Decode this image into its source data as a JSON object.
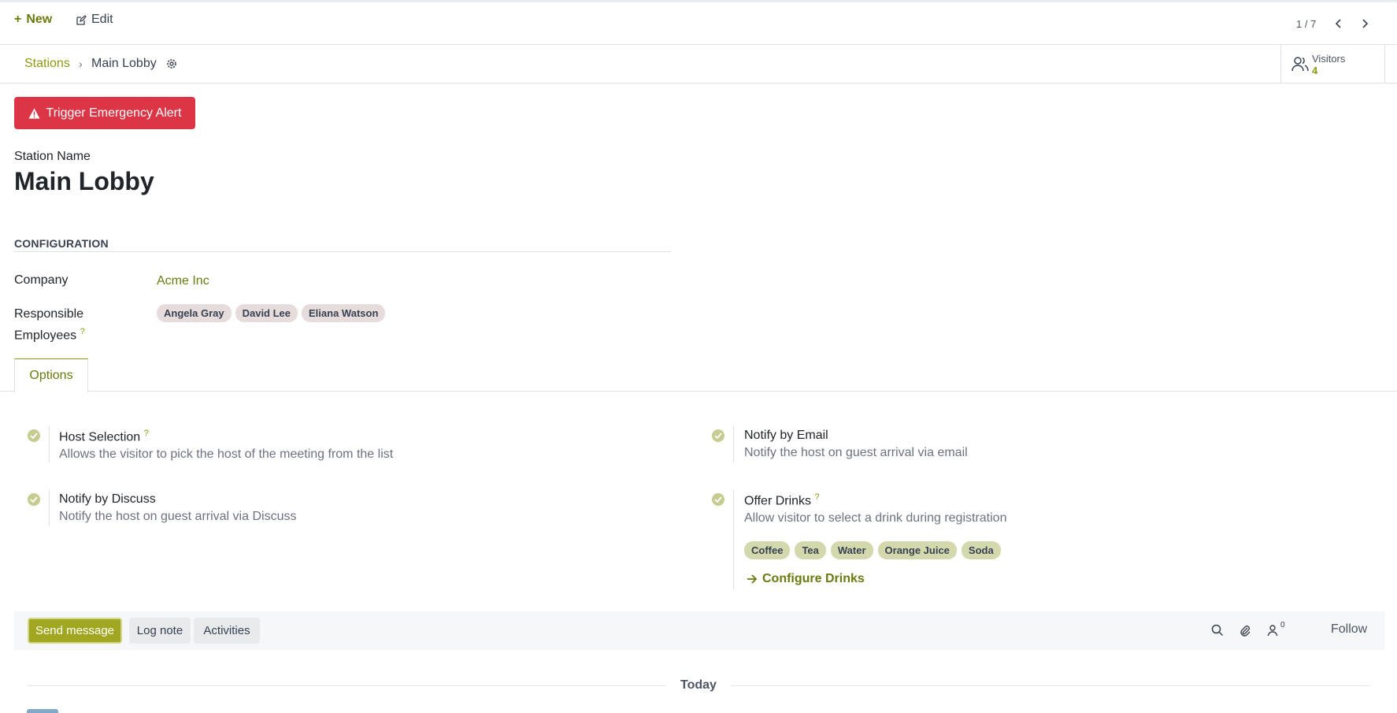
{
  "toolbar": {
    "new_label": "New",
    "edit_label": "Edit",
    "pager": "1 / 7"
  },
  "breadcrumb": {
    "parent": "Stations",
    "current": "Main Lobby"
  },
  "visitors": {
    "label": "Visitors",
    "count": "4"
  },
  "alert": {
    "label": "Trigger Emergency Alert"
  },
  "station": {
    "label": "Station Name",
    "name": "Main Lobby"
  },
  "configuration": {
    "title": "CONFIGURATION",
    "company_label": "Company",
    "company_value": "Acme Inc",
    "responsible_label_1": "Responsible",
    "responsible_label_2": "Employees",
    "help_mark": "?",
    "employees": [
      "Angela Gray",
      "David Lee",
      "Eliana Watson"
    ]
  },
  "tabs": {
    "options": "Options"
  },
  "options": {
    "host_selection": {
      "title": "Host Selection",
      "desc": "Allows the visitor to pick the host of the meeting from the list"
    },
    "notify_email": {
      "title": "Notify by Email",
      "desc": "Notify the host on guest arrival via email"
    },
    "notify_discuss": {
      "title": "Notify by Discuss",
      "desc": "Notify the host on guest arrival via Discuss"
    },
    "offer_drinks": {
      "title": "Offer Drinks",
      "desc": "Allow visitor to select a drink during registration"
    },
    "drinks": [
      "Coffee",
      "Tea",
      "Water",
      "Orange Juice",
      "Soda"
    ],
    "configure_drinks": "Configure Drinks"
  },
  "chatter": {
    "send_message": "Send message",
    "log_note": "Log note",
    "activities": "Activities",
    "follower_count": "0",
    "follow": "Follow",
    "today": "Today"
  },
  "colors": {
    "accent": "#8a9a10",
    "danger": "#dc3545",
    "send": "#a1a720"
  }
}
